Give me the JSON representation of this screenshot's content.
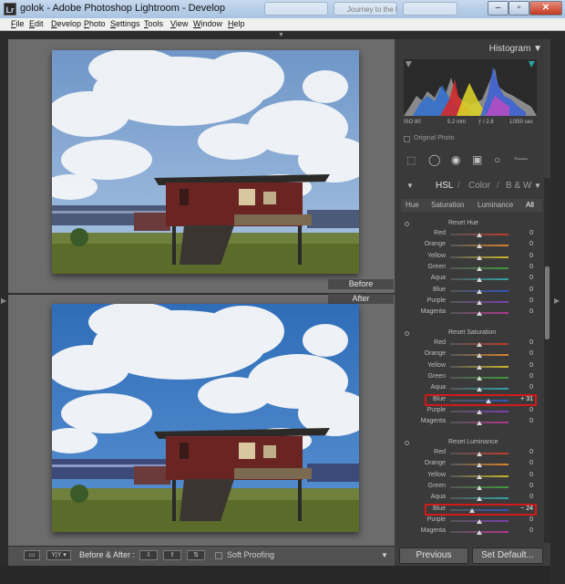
{
  "window": {
    "title": "golok - Adobe Photoshop Lightroom - Develop",
    "app_icon_letter": "Lr",
    "ghost_tab_2": "Journey to the R..."
  },
  "menu": [
    {
      "label": "File",
      "u": "F",
      "rest": "ile"
    },
    {
      "label": "Edit",
      "u": "E",
      "rest": "dit"
    },
    {
      "label": "Develop",
      "u": "D",
      "rest": "evelop"
    },
    {
      "label": "Photo",
      "u": "P",
      "rest": "hoto"
    },
    {
      "label": "Settings",
      "u": "S",
      "rest": "ettings"
    },
    {
      "label": "Tools",
      "u": "T",
      "rest": "ools"
    },
    {
      "label": "View",
      "u": "V",
      "rest": "iew"
    },
    {
      "label": "Window",
      "u": "W",
      "rest": "indow"
    },
    {
      "label": "Help",
      "u": "H",
      "rest": "elp"
    }
  ],
  "labels": {
    "before": "Before",
    "after": "After"
  },
  "histogram": {
    "title": "Histogram",
    "iso": "ISO 80",
    "focal": "5.2 mm",
    "aperture": "ƒ / 2.8",
    "shutter": "1/350 sec",
    "original_photo": "Original Photo"
  },
  "hsl": {
    "title_hsl": "HSL",
    "title_color": "Color",
    "title_bw": "B & W",
    "tabs": [
      "Hue",
      "Saturation",
      "Luminance",
      "All"
    ],
    "groups": [
      {
        "name": "Reset Hue",
        "rows": [
          {
            "label": "Red",
            "value": "0",
            "pos": 0.5
          },
          {
            "label": "Orange",
            "value": "0",
            "pos": 0.5
          },
          {
            "label": "Yellow",
            "value": "0",
            "pos": 0.5
          },
          {
            "label": "Green",
            "value": "0",
            "pos": 0.5
          },
          {
            "label": "Aqua",
            "value": "0",
            "pos": 0.5
          },
          {
            "label": "Blue",
            "value": "0",
            "pos": 0.5
          },
          {
            "label": "Purple",
            "value": "0",
            "pos": 0.5
          },
          {
            "label": "Magenta",
            "value": "0",
            "pos": 0.5
          }
        ]
      },
      {
        "name": "Reset Saturation",
        "rows": [
          {
            "label": "Red",
            "value": "0",
            "pos": 0.5
          },
          {
            "label": "Orange",
            "value": "0",
            "pos": 0.5
          },
          {
            "label": "Yellow",
            "value": "0",
            "pos": 0.5
          },
          {
            "label": "Green",
            "value": "0",
            "pos": 0.5
          },
          {
            "label": "Aqua",
            "value": "0",
            "pos": 0.5
          },
          {
            "label": "Blue",
            "value": "+ 31",
            "pos": 0.655,
            "highlight": true
          },
          {
            "label": "Purple",
            "value": "0",
            "pos": 0.5
          },
          {
            "label": "Magenta",
            "value": "0",
            "pos": 0.5
          }
        ]
      },
      {
        "name": "Reset Luminance",
        "rows": [
          {
            "label": "Red",
            "value": "0",
            "pos": 0.5
          },
          {
            "label": "Orange",
            "value": "0",
            "pos": 0.5
          },
          {
            "label": "Yellow",
            "value": "0",
            "pos": 0.5
          },
          {
            "label": "Green",
            "value": "0",
            "pos": 0.5
          },
          {
            "label": "Aqua",
            "value": "0",
            "pos": 0.5
          },
          {
            "label": "Blue",
            "value": "− 24",
            "pos": 0.38,
            "highlight": true
          },
          {
            "label": "Purple",
            "value": "0",
            "pos": 0.5
          },
          {
            "label": "Magenta",
            "value": "0",
            "pos": 0.5
          }
        ]
      }
    ]
  },
  "toolbar": {
    "before_after": "Before & After :",
    "soft_proofing": "Soft Proofing"
  },
  "buttons": {
    "previous": "Previous",
    "set_default": "Set Default..."
  },
  "track_colors": {
    "Red": "#c0392b",
    "Orange": "#d9822b",
    "Yellow": "#c9b52a",
    "Green": "#3f9a3a",
    "Aqua": "#2fa3a6",
    "Blue": "#3453b8",
    "Purple": "#7b3fb0",
    "Magenta": "#b0368e"
  }
}
